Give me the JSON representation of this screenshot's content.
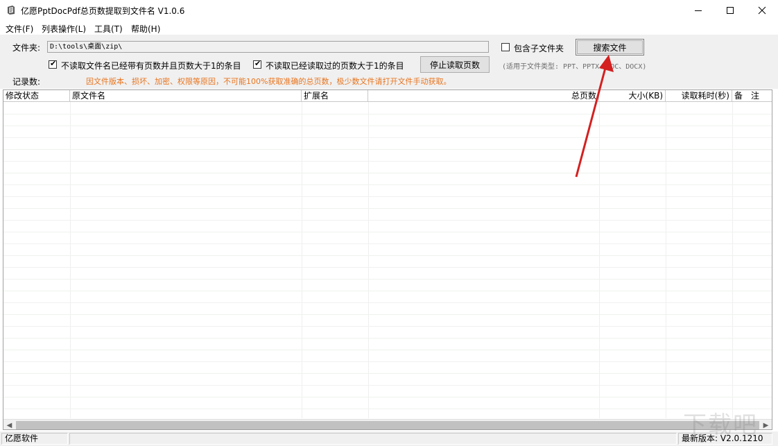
{
  "window": {
    "title": "亿愿PptDocPdf总页数提取到文件名 V1.0.6",
    "icon": "app-icon",
    "controls": {
      "minimize": "minimize-icon",
      "maximize": "maximize-icon",
      "close": "close-icon"
    }
  },
  "menubar": {
    "items": [
      {
        "label": "文件(F)"
      },
      {
        "label": "列表操作(L)"
      },
      {
        "label": "工具(T)"
      },
      {
        "label": "帮助(H)"
      }
    ]
  },
  "toolbar": {
    "folder_label": "文件夹:",
    "folder_value": "D:\\tools\\桌面\\zip\\",
    "include_subfolders_label": "包含子文件夹",
    "include_subfolders_checked": false,
    "search_button": "搜索文件",
    "skip_named_label": "不读取文件名已经带有页数并且页数大于1的条目",
    "skip_named_checked": true,
    "skip_read_label": "不读取已经读取过的页数大于1的条目",
    "skip_read_checked": true,
    "stop_button": "停止读取页数",
    "file_types_hint": "(适用于文件类型: PPT、PPTX、DOC、DOCX)",
    "records_label": "记录数:",
    "records_count": "",
    "warning_text": "因文件版本、损坏、加密、权限等原因，不可能100%获取准确的总页数，极少数文件请打开文件手动获取。",
    "warning_color": "#e8741e"
  },
  "table": {
    "columns": [
      {
        "label": "修改状态"
      },
      {
        "label": "原文件名"
      },
      {
        "label": "扩展名"
      },
      {
        "label": "总页数"
      },
      {
        "label": "大小(KB)"
      },
      {
        "label": "读取耗时(秒)"
      },
      {
        "label": "备　注"
      }
    ],
    "rows": []
  },
  "statusbar": {
    "company": "亿愿软件",
    "middle": "",
    "latest_version": "最新版本: V2.0.1210"
  },
  "annotation": {
    "arrow_color": "#d42020"
  },
  "watermark": "下载吧"
}
